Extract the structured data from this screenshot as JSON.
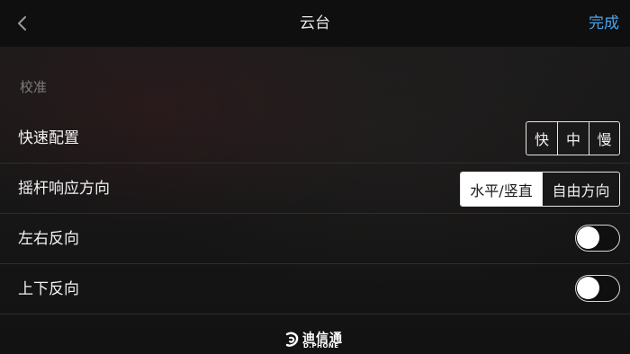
{
  "header": {
    "back_icon": "chevron-left-icon",
    "title": "云台",
    "done_label": "完成",
    "accent_color": "#4aa5f0"
  },
  "section": {
    "title": "校准"
  },
  "rows": [
    {
      "label": "快速配置",
      "control": "segmented",
      "options": [
        "快",
        "中",
        "慢"
      ],
      "selected": null
    },
    {
      "label": "摇杆响应方向",
      "control": "segmented",
      "options": [
        "水平/竖直",
        "自由方向"
      ],
      "selected": "水平/竖直"
    },
    {
      "label": "左右反向",
      "control": "toggle",
      "on": false
    },
    {
      "label": "上下反向",
      "control": "toggle",
      "on": false
    }
  ],
  "watermark": {
    "text_cn": "迪信通",
    "text_en": "D.PHONE"
  }
}
